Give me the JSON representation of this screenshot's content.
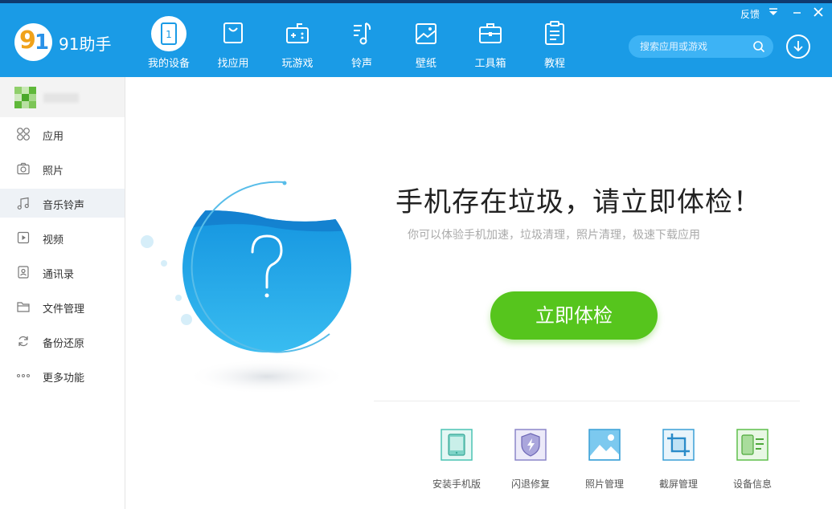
{
  "app": {
    "brand": "91助手"
  },
  "header": {
    "nav": [
      {
        "label": "我的设备",
        "icon": "device-icon",
        "active": true
      },
      {
        "label": "找应用",
        "icon": "shopping-bag-icon"
      },
      {
        "label": "玩游戏",
        "icon": "gamepad-icon"
      },
      {
        "label": "铃声",
        "icon": "music-note-icon"
      },
      {
        "label": "壁纸",
        "icon": "wallpaper-icon"
      },
      {
        "label": "工具箱",
        "icon": "toolbox-icon"
      },
      {
        "label": "教程",
        "icon": "clipboard-icon"
      }
    ],
    "feedback_label": "反馈",
    "search_placeholder": "搜索应用或游戏"
  },
  "sidebar": {
    "items": [
      {
        "label": "应用",
        "icon": "apps-grid-icon"
      },
      {
        "label": "照片",
        "icon": "camera-icon"
      },
      {
        "label": "音乐铃声",
        "icon": "music-icon",
        "active": true
      },
      {
        "label": "视频",
        "icon": "video-icon"
      },
      {
        "label": "通讯录",
        "icon": "contacts-icon"
      },
      {
        "label": "文件管理",
        "icon": "folder-icon"
      },
      {
        "label": "备份还原",
        "icon": "sync-icon"
      },
      {
        "label": "更多功能",
        "icon": "more-dots-icon"
      }
    ]
  },
  "main": {
    "headline": "手机存在垃圾，请立即体检！",
    "subline": "你可以体验手机加速，垃圾清理，照片清理，极速下载应用",
    "cta_label": "立即体检",
    "tools": [
      {
        "label": "安装手机版",
        "icon": "tablet-icon"
      },
      {
        "label": "闪退修复",
        "icon": "shield-bolt-icon"
      },
      {
        "label": "照片管理",
        "icon": "photo-icon"
      },
      {
        "label": "截屏管理",
        "icon": "crop-icon"
      },
      {
        "label": "设备信息",
        "icon": "device-info-icon"
      }
    ]
  },
  "colors": {
    "header": "#1a9be6",
    "cta": "#56c51d",
    "water": "#1bb0ea"
  }
}
